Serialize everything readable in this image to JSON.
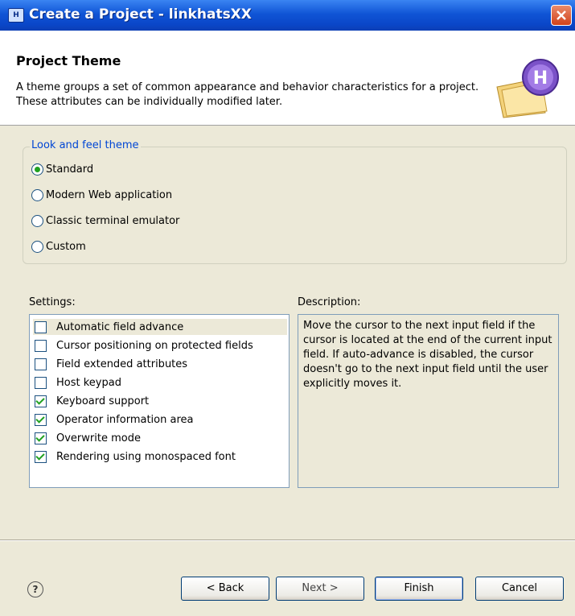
{
  "window": {
    "title": "Create a Project - linkhatsXX",
    "icon": "wizard-app-icon"
  },
  "header": {
    "title": "Project Theme",
    "description": "A theme groups a set of common appearance and behavior characteristics for a project. These attributes can be individually modified later.",
    "icon": "project-folder-h-icon"
  },
  "theme_group": {
    "legend": "Look and feel theme",
    "options": [
      {
        "label": "Standard",
        "selected": true
      },
      {
        "label": "Modern Web application",
        "selected": false
      },
      {
        "label": "Classic terminal emulator",
        "selected": false
      },
      {
        "label": "Custom",
        "selected": false
      }
    ]
  },
  "settings": {
    "label": "Settings:",
    "items": [
      {
        "label": "Automatic field advance",
        "checked": false,
        "highlighted": true
      },
      {
        "label": "Cursor positioning on protected fields",
        "checked": false
      },
      {
        "label": "Field extended attributes",
        "checked": false
      },
      {
        "label": "Host keypad",
        "checked": false
      },
      {
        "label": "Keyboard support",
        "checked": true
      },
      {
        "label": "Operator information area",
        "checked": true
      },
      {
        "label": "Overwrite mode",
        "checked": true
      },
      {
        "label": "Rendering using monospaced font",
        "checked": true
      }
    ]
  },
  "description": {
    "label": "Description:",
    "text": "Move the cursor to the next input field if the cursor is located at the end of the current input field. If auto-advance is disabled, the cursor doesn't go to the next input field until the user explicitly moves it."
  },
  "buttons": {
    "back": "< Back",
    "next": "Next >",
    "finish": "Finish",
    "cancel": "Cancel"
  },
  "colors": {
    "titlebar": "#0a46c8",
    "group_legend": "#0046d5",
    "check": "#21a121"
  }
}
